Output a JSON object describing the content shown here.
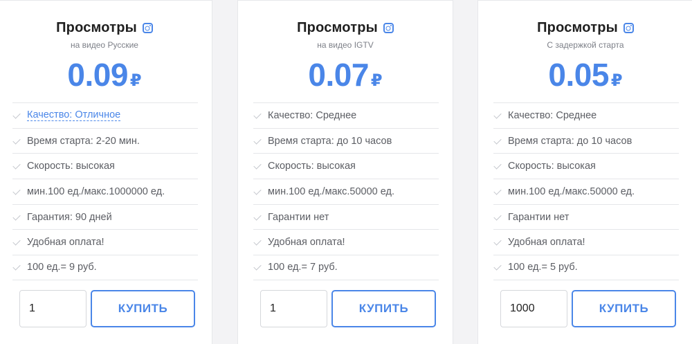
{
  "colors": {
    "accent": "#4a86e8",
    "text_muted": "#5b5d63",
    "divider": "#e5e6e9"
  },
  "cards": [
    {
      "title": "Просмотры",
      "title_icon": "instagram-icon",
      "subtitle": "на видео Русские",
      "price": "0.09",
      "currency": "₽",
      "features": [
        "Качество: Отличное",
        "Время старта: 2-20 мин.",
        "Скорость: высокая",
        "мин.100 ед./макс.1000000 ед.",
        "Гарантия: 90 дней",
        "Удобная оплата!",
        "100 ед.= 9 руб."
      ],
      "quantity": "1",
      "buy_label": "КУПИТЬ"
    },
    {
      "title": "Просмотры",
      "title_icon": "instagram-icon",
      "subtitle": "на видео IGTV",
      "price": "0.07",
      "currency": "₽",
      "features": [
        "Качество: Среднее",
        "Время старта: до 10 часов",
        "Скорость: высокая",
        "мин.100 ед./макс.50000 ед.",
        "Гарантии нет",
        "Удобная оплата!",
        "100 ед.= 7 руб."
      ],
      "quantity": "1",
      "buy_label": "КУПИТЬ"
    },
    {
      "title": "Просмотры",
      "title_icon": "instagram-icon",
      "subtitle": "С задержкой старта",
      "price": "0.05",
      "currency": "₽",
      "features": [
        "Качество: Среднее",
        "Время старта: до 10 часов",
        "Скорость: высокая",
        "мин.100 ед./макс.50000 ед.",
        "Гарантии нет",
        "Удобная оплата!",
        "100 ед.= 5 руб."
      ],
      "quantity": "1000",
      "buy_label": "КУПИТЬ"
    }
  ]
}
